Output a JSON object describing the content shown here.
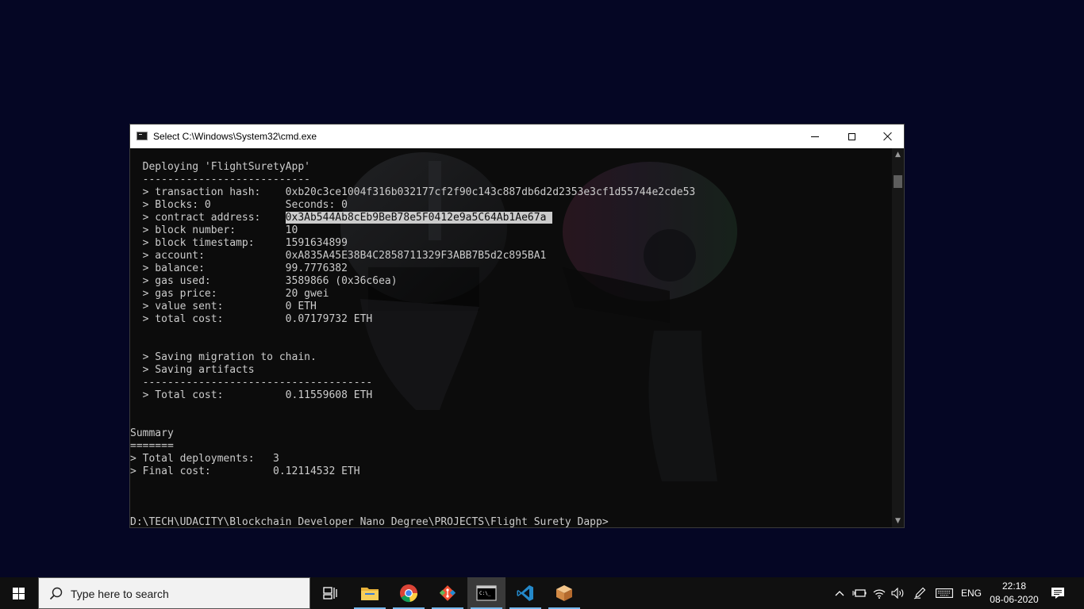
{
  "window": {
    "title": "Select C:\\Windows\\System32\\cmd.exe"
  },
  "console": {
    "lines": [
      "  Deploying 'FlightSuretyApp'",
      "  ---------------------------",
      "  > transaction hash:    0xb20c3ce1004f316b032177cf2f90c143c887db6d2d2353e3cf1d55744e2cde53",
      "  > Blocks: 0            Seconds: 0",
      "  > contract address:    ",
      "  > block number:        10",
      "  > block timestamp:     1591634899",
      "  > account:             0xA835A45E38B4C2858711329F3ABB7B5d2c895BA1",
      "  > balance:             99.7776382",
      "  > gas used:            3589866 (0x36c6ea)",
      "  > gas price:           20 gwei",
      "  > value sent:          0 ETH",
      "  > total cost:          0.07179732 ETH",
      "",
      "",
      "  > Saving migration to chain.",
      "  > Saving artifacts",
      "  -------------------------------------",
      "  > Total cost:          0.11559608 ETH",
      "",
      "",
      "Summary",
      "=======",
      "> Total deployments:   3",
      "> Final cost:          0.12114532 ETH",
      "",
      "",
      "",
      "D:\\TECH\\UDACITY\\Blockchain Developer Nano Degree\\PROJECTS\\Flight Surety Dapp>"
    ],
    "selected_text": "0x3Ab544Ab8cEb9BeB78e5F0412e9a5C64Ab1Ae67a "
  },
  "taskbar": {
    "search_placeholder": "Type here to search",
    "apps": [
      {
        "name": "task-view",
        "icon": "task-view-icon"
      },
      {
        "name": "file-explorer",
        "icon": "folder-icon"
      },
      {
        "name": "chrome",
        "icon": "chrome-icon"
      },
      {
        "name": "git",
        "icon": "git-icon"
      },
      {
        "name": "cmd",
        "icon": "terminal-icon"
      },
      {
        "name": "vscode",
        "icon": "vscode-icon"
      },
      {
        "name": "package-app",
        "icon": "box-icon"
      }
    ],
    "language": "ENG",
    "time": "22:18",
    "date": "08-06-2020"
  },
  "colors": {
    "desktop": "#050624",
    "console_bg": "#0c0c0c",
    "console_text": "#cccccc",
    "taskbar": "#101010",
    "accent": "#76b9ed"
  }
}
